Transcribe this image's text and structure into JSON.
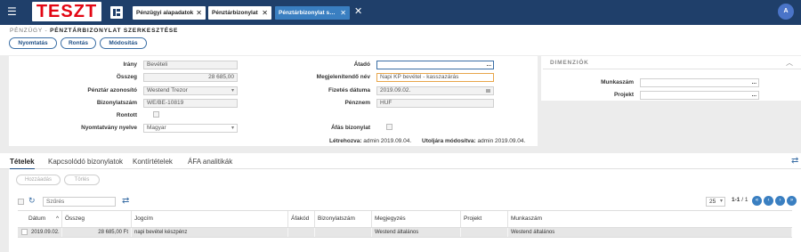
{
  "topbar": {
    "logo_text": "TESZT",
    "tabs": [
      {
        "label": "Pénzügyi alapadatok"
      },
      {
        "label": "Pénztárbizonylat"
      },
      {
        "label": "Pénztárbizonylat szerkesztése"
      }
    ],
    "avatar_letter": "A"
  },
  "header": {
    "breadcrumb_parent": "PÉNZÜGY",
    "breadcrumb_sep": " - ",
    "page_title": "PÉNZTÁRBIZONYLAT SZERKESZTÉSE",
    "buttons": {
      "print": "Nyomtatás",
      "storno": "Rontás",
      "changes": "Módosítás"
    }
  },
  "form": {
    "left": {
      "irany_label": "Irány",
      "irany_value": "Bevételi",
      "osszeg_label": "Összeg",
      "osszeg_value": "28 685,00",
      "penztar_label": "Pénztár azonosító",
      "penztar_value": "Westend Trezor",
      "bizszam_label": "Bizonylatszám",
      "bizszam_value": "WE/BE-10819",
      "rontott_label": "Rontott",
      "nyelv_label": "Nyomtatvány nyelve",
      "nyelv_value": "Magyar"
    },
    "right": {
      "atado_label": "Átadó",
      "atado_value": "",
      "megjnev_label": "Megjelenítendő név",
      "megjnev_value": "Napi KP bevétel - kasszazárás",
      "fizdatum_label": "Fizetés dátuma",
      "fizdatum_value": "2019.09.02.",
      "penznem_label": "Pénznem",
      "penznem_value": "HUF",
      "afas_label": "Áfás bizonylat"
    },
    "meta": {
      "created_label": "Létrehozva:",
      "created_value": "admin 2019.09.04.",
      "modified_label": "Utoljára módosítva:",
      "modified_value": "admin 2019.09.04."
    }
  },
  "dimensions": {
    "title": "DIMENZIÓK",
    "munkaszam_label": "Munkaszám",
    "projekt_label": "Projekt"
  },
  "subtabs": [
    "Tételek",
    "Kapcsolódó bizonylatok",
    "Kontírtételek",
    "ÁFA analitikák"
  ],
  "grid": {
    "add_button": "Hozzáadás",
    "delete_button": "Törlés",
    "filter_placeholder": "Szűrés",
    "page_size": "25",
    "page_info": "1-1",
    "page_total": " / 1",
    "columns": [
      "Dátum",
      "Összeg",
      "Jogcím",
      "Áfakód",
      "Bizonylatszám",
      "Megjegyzés",
      "Projekt",
      "Munkaszám"
    ],
    "rows": [
      [
        "2019.09.02.",
        "28 685,00 Ft",
        "napi bevétel készpénz",
        "",
        "",
        "Westend általános",
        "",
        "Westend általános"
      ]
    ]
  },
  "colors": {
    "topbar": "#1f3f6a",
    "accent": "#3a7fc1",
    "logo_red": "#e30613"
  }
}
